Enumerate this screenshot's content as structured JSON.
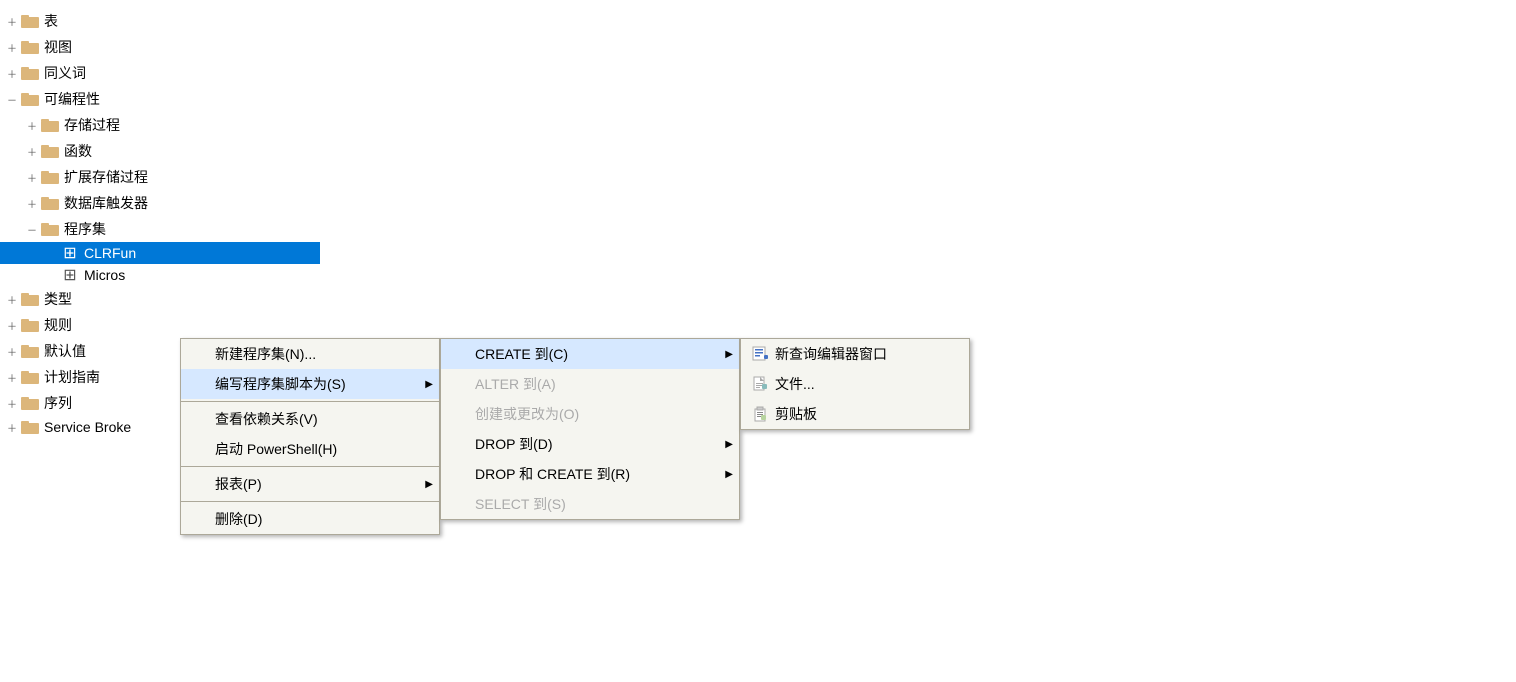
{
  "tree": {
    "items": [
      {
        "id": "tables",
        "label": "表",
        "indent": "indent-1",
        "expandable": true,
        "expanded": false,
        "type": "folder"
      },
      {
        "id": "views",
        "label": "视图",
        "indent": "indent-1",
        "expandable": true,
        "expanded": false,
        "type": "folder"
      },
      {
        "id": "synonyms",
        "label": "同义词",
        "indent": "indent-1",
        "expandable": true,
        "expanded": false,
        "type": "folder"
      },
      {
        "id": "programmability",
        "label": "可编程性",
        "indent": "indent-1",
        "expandable": true,
        "expanded": true,
        "type": "folder"
      },
      {
        "id": "storedproc",
        "label": "存储过程",
        "indent": "indent-2",
        "expandable": true,
        "expanded": false,
        "type": "folder"
      },
      {
        "id": "functions",
        "label": "函数",
        "indent": "indent-2",
        "expandable": true,
        "expanded": false,
        "type": "folder"
      },
      {
        "id": "extstoredproc",
        "label": "扩展存储过程",
        "indent": "indent-2",
        "expandable": true,
        "expanded": false,
        "type": "folder"
      },
      {
        "id": "dbtriggers",
        "label": "数据库触发器",
        "indent": "indent-2",
        "expandable": true,
        "expanded": false,
        "type": "folder"
      },
      {
        "id": "assemblies",
        "label": "程序集",
        "indent": "indent-2",
        "expandable": true,
        "expanded": true,
        "type": "folder"
      },
      {
        "id": "clrfunc",
        "label": "CLRFun",
        "indent": "indent-3",
        "expandable": false,
        "expanded": false,
        "type": "assembly",
        "selected": true
      },
      {
        "id": "micros",
        "label": "Micros",
        "indent": "indent-3",
        "expandable": false,
        "expanded": false,
        "type": "assembly"
      },
      {
        "id": "types",
        "label": "类型",
        "indent": "indent-1",
        "expandable": true,
        "expanded": false,
        "type": "folder"
      },
      {
        "id": "rules",
        "label": "规则",
        "indent": "indent-1",
        "expandable": true,
        "expanded": false,
        "type": "folder"
      },
      {
        "id": "defaults",
        "label": "默认值",
        "indent": "indent-1",
        "expandable": true,
        "expanded": false,
        "type": "folder"
      },
      {
        "id": "planguide",
        "label": "计划指南",
        "indent": "indent-1",
        "expandable": true,
        "expanded": false,
        "type": "folder"
      },
      {
        "id": "sequences",
        "label": "序列",
        "indent": "indent-1",
        "expandable": true,
        "expanded": false,
        "type": "folder"
      },
      {
        "id": "servicebroker",
        "label": "Service Broke",
        "indent": "indent-1",
        "expandable": true,
        "expanded": false,
        "type": "folder"
      }
    ]
  },
  "contextMenu1": {
    "items": [
      {
        "id": "new-assembly",
        "label": "新建程序集(N)...",
        "hasArrow": false,
        "disabled": false,
        "separator": false
      },
      {
        "id": "script-assembly",
        "label": "编写程序集脚本为(S)",
        "hasArrow": true,
        "disabled": false,
        "separator": false,
        "active": true
      },
      {
        "id": "sep1",
        "separator": true
      },
      {
        "id": "view-deps",
        "label": "查看依赖关系(V)",
        "hasArrow": false,
        "disabled": false,
        "separator": false
      },
      {
        "id": "powershell",
        "label": "启动 PowerShell(H)",
        "hasArrow": false,
        "disabled": false,
        "separator": false
      },
      {
        "id": "sep2",
        "separator": true
      },
      {
        "id": "reports",
        "label": "报表(P)",
        "hasArrow": true,
        "disabled": false,
        "separator": false
      },
      {
        "id": "sep3",
        "separator": true
      },
      {
        "id": "delete",
        "label": "删除(D)",
        "hasArrow": false,
        "disabled": false,
        "separator": false
      }
    ]
  },
  "contextMenu2": {
    "items": [
      {
        "id": "create-to",
        "label": "CREATE 到(C)",
        "hasArrow": true,
        "disabled": false,
        "separator": false,
        "active": true
      },
      {
        "id": "alter-to",
        "label": "ALTER 到(A)",
        "hasArrow": false,
        "disabled": true,
        "separator": false
      },
      {
        "id": "create-or-alter",
        "label": "创建或更改为(O)",
        "hasArrow": false,
        "disabled": true,
        "separator": false
      },
      {
        "id": "drop-to",
        "label": "DROP 到(D)",
        "hasArrow": true,
        "disabled": false,
        "separator": false
      },
      {
        "id": "drop-and-create",
        "label": "DROP 和 CREATE 到(R)",
        "hasArrow": true,
        "disabled": false,
        "separator": false
      },
      {
        "id": "select-to",
        "label": "SELECT 到(S)",
        "hasArrow": false,
        "disabled": true,
        "separator": false
      }
    ]
  },
  "contextMenu3": {
    "items": [
      {
        "id": "new-query-window",
        "label": "新查询编辑器窗口",
        "hasArrow": false,
        "disabled": false,
        "separator": false
      },
      {
        "id": "file",
        "label": "文件...",
        "hasArrow": false,
        "disabled": false,
        "separator": false
      },
      {
        "id": "clipboard",
        "label": "剪贴板",
        "hasArrow": false,
        "disabled": false,
        "separator": false
      }
    ]
  }
}
